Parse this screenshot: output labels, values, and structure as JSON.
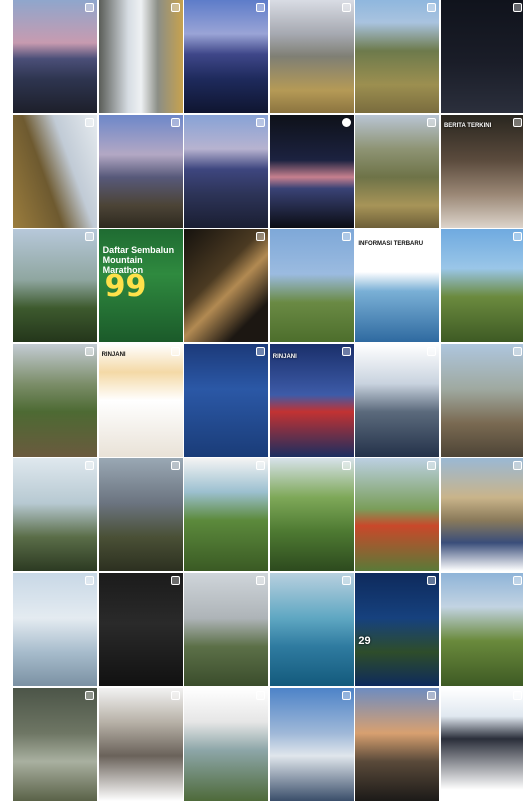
{
  "tiles": [
    {
      "bg": "linear-gradient(#8fa6cc 0%,#c79bb0 38%,#4b4f78 52%,#2e3550 70%,#1d1f2a 100%)",
      "badge": "multi"
    },
    {
      "bg": "linear-gradient(90deg,#5a5d58 0%,#d7dde3 35%,#eef1f3 50%,#8b8e86 70%,#c7a24e 100%)",
      "badge": "multi"
    },
    {
      "bg": "linear-gradient(#5d7cc9 0%,#9aa4d6 30%,#3f4789 48%,#1e2a5c 70%,#0f1530 100%)",
      "badge": "multi"
    },
    {
      "bg": "linear-gradient(#d9dce4 0%,#a6a9b1 30%,#7f7f74 50%,#b59a56 80%,#8b7440 100%)",
      "badge": "multi"
    },
    {
      "bg": "linear-gradient(#8fb7de 0%,#a9c3df 20%,#6d7a4c 45%,#9c8f50 75%,#7a6c3e 100%)",
      "badge": "multi"
    },
    {
      "bg": "linear-gradient(#10131c 0%,#1a1d28 55%,#2b2f3c 100%)",
      "badge": "multi"
    },
    {
      "bg": "linear-gradient(70deg,#9b7d3d 0%,#6e5a30 40%,#c1cbd6 65%,#e6ebef 100%)",
      "badge": "multi"
    },
    {
      "bg": "linear-gradient(#6d87c9 0%,#b3a8c4 35%,#57597a 55%,#4c4436 80%,#2e291f 100%)",
      "badge": "multi"
    },
    {
      "bg": "linear-gradient(#87a2d6 0%,#b7b3d0 30%,#3e467f 48%,#2d3458 70%,#1a1e32 100%)",
      "badge": "multi"
    },
    {
      "bg": "linear-gradient(#0e1119 0%,#1c2240 40%,#c7808e 55%,#3a4376 65%,#0b0d14 100%)",
      "badge": "video"
    },
    {
      "bg": "linear-gradient(#b9c5d4 0%,#8e9474 30%,#6e7348 55%,#a79458 80%,#6d5f38 100%)",
      "badge": "multi"
    },
    {
      "bg": "linear-gradient(#29261f 0%,#5b4b3d 40%,#9a8775 70%,#ddd4cb 100%)",
      "badge": "multi",
      "cap": "BERITA TERKINI",
      "captop": 8
    },
    {
      "bg": "linear-gradient(#b7c8da 0%,#8fa6a0 45%,#3d5a2e 70%,#24361b 100%)",
      "badge": "multi"
    },
    {
      "bg": "linear-gradient(#1f6b32 0%,#2f8a3f 40%,#1b5a2a 100%)",
      "badge": "none",
      "poster": true
    },
    {
      "bg": "linear-gradient(135deg,#15120e 0%,#4b3a22 40%,#b28a52 55%,#1c1712 80%)",
      "badge": "multi"
    },
    {
      "bg": "linear-gradient(#7ea8d8 0%,#9bbbe0 40%,#6a8a44 65%,#4d6e2c 100%)",
      "badge": "multi"
    },
    {
      "bg": "linear-gradient(#ffffff 0%,#ffffff 38%,#7ab0d6 55%,#2f6aa0 100%)",
      "badge": "multi",
      "cap": "INFORMASI TERBARU",
      "captop": 12,
      "capdark": true
    },
    {
      "bg": "linear-gradient(#6faae0 0%,#9ac6e8 35%,#6b8a3e 60%,#3e5a24 100%)",
      "badge": "multi"
    },
    {
      "bg": "linear-gradient(#c4ccd4 0%,#7c8e6a 35%,#4d6a33 60%,#6a5a3e 100%)",
      "badge": "multi"
    },
    {
      "bg": "linear-gradient(#ffffff 0%,#f4d9a6 25%,#ffffff 50%,#e9e2d7 100%)",
      "badge": "multi",
      "cap": "RINJANI",
      "captop": 8,
      "capdark": true
    },
    {
      "bg": "linear-gradient(#1c3a7a 0%,#2b58a6 40%,#1a3c78 100%)",
      "badge": "multi"
    },
    {
      "bg": "linear-gradient(#1a2f6a 0%,#3d5ba8 45%,#c23232 60%,#1b2e60 100%)",
      "badge": "multi",
      "cap": "RINJANI",
      "captop": 10
    },
    {
      "bg": "linear-gradient(#ffffff 0%,#c9d3df 35%,#5b6a7c 60%,#24324a 100%)",
      "badge": "multi"
    },
    {
      "bg": "linear-gradient(#aec6de 0%,#9fa9a0 40%,#7a6a52 70%,#4d4436 100%)",
      "badge": "multi"
    },
    {
      "bg": "linear-gradient(#dfe8ee 0%,#b7c9d2 40%,#5a6d48 70%,#2c3a22 100%)",
      "badge": "multi"
    },
    {
      "bg": "linear-gradient(#9aa8b4 0%,#6b7480 40%,#4a5036 70%,#2c3020 100%)",
      "badge": "multi"
    },
    {
      "bg": "linear-gradient(#f4f4f4 0%,#9cc0d0 30%,#5c8a3c 55%,#3a5a24 100%)",
      "badge": "multi"
    },
    {
      "bg": "linear-gradient(#d7e2ea 0%,#7ea858 35%,#4e7a32 65%,#2d4a1e 100%)",
      "badge": "multi"
    },
    {
      "bg": "linear-gradient(#bcd0e2 0%,#7a9e5a 45%,#c9482a 60%,#5a7a38 100%)",
      "badge": "multi"
    },
    {
      "bg": "linear-gradient(#9ab8d4 0%,#c9b48a 35%,#8a7a5a 55%,#3a4e7a 75%,#ffffff 100%)",
      "badge": "multi"
    },
    {
      "bg": "linear-gradient(#c8d8e6 0%,#e4ebf1 40%,#a7bccc 70%,#7b91a3 100%)",
      "badge": "multi"
    },
    {
      "bg": "linear-gradient(#1b1b1b 0%,#2a2a2a 45%,#111 100%)",
      "badge": "multi"
    },
    {
      "bg": "linear-gradient(#cfd5da 0%,#aeb4b8 40%,#5c7048 65%,#3b4d2c 100%)",
      "badge": "multi"
    },
    {
      "bg": "linear-gradient(#b8d0df 0%,#5fa7c2 40%,#2f7ba0 65%,#135a7c 100%)",
      "badge": "multi"
    },
    {
      "bg": "linear-gradient(#0e2a5c 0%,#16417e 40%,#2e4d2a 70%,#0e2a5c 100%)",
      "badge": "multi",
      "cap": "29",
      "captop": 62,
      "big": true
    },
    {
      "bg": "linear-gradient(#8fb4d8 0%,#c2d3e2 30%,#6a8a3c 60%,#3e5a24 100%)",
      "badge": "multi"
    },
    {
      "bg": "linear-gradient(#4c5548 0%,#6e7664 40%,#a9b0a0 65%,#5a6248 100%)",
      "badge": "multi"
    },
    {
      "bg": "linear-gradient(#f2f2f2 0%,#b8b2a8 30%,#6a625a 60%,#ffffff 100%)",
      "badge": "multi"
    },
    {
      "bg": "linear-gradient(#ffffff 0%,#e6e6e6 30%,#8da6a8 55%,#4e6a3a 100%)",
      "badge": "multi"
    },
    {
      "bg": "linear-gradient(#4d83c8 0%,#9fb8d8 40%,#e0e6ec 60%,#3a4e6a 100%)",
      "badge": "multi"
    },
    {
      "bg": "linear-gradient(#6e8cc0 0%,#d8a070 40%,#5a4a3a 65%,#1c1a18 100%)",
      "badge": "multi"
    },
    {
      "bg": "linear-gradient(#ffffff 0%,#e0e8f0 25%,#2a2e3a 45%,#ffffff 90%)",
      "badge": "multi"
    }
  ],
  "poster": {
    "title": "Daftar Sembalun Mountain Marathon",
    "price": "99"
  }
}
